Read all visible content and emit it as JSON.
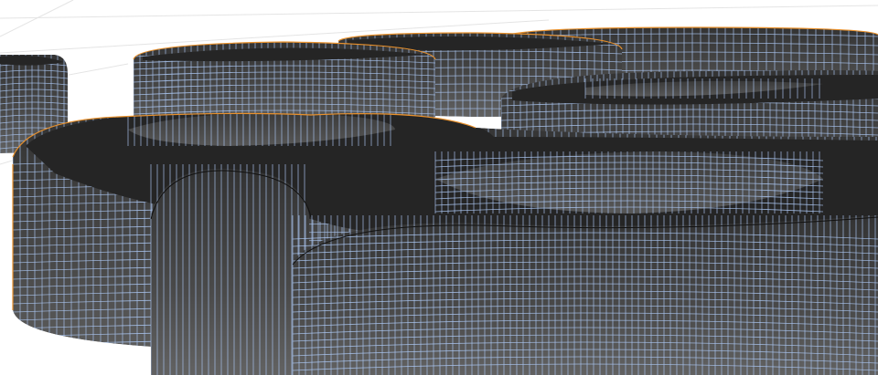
{
  "viewport": {
    "mode": "edit-mode-wireframe-overlay",
    "background_color": "#ffffff",
    "grid_color": "#e6e6e6",
    "surface_dark": "#2b2b2b",
    "surface_light": "#5e5e5e",
    "top_face_color": "#252525",
    "wire_color": "#a9c4ef",
    "selection_outline_color": "#e8902b",
    "objects": [
      {
        "label": "hole-left",
        "shape": "rounded-slot"
      },
      {
        "label": "hole-right",
        "shape": "rounded-slot"
      },
      {
        "label": "pill-far-left",
        "shape": "pill"
      },
      {
        "label": "pill-back-left",
        "shape": "pill"
      },
      {
        "label": "pill-back-mid",
        "shape": "pill"
      },
      {
        "label": "pill-right",
        "shape": "pill"
      },
      {
        "label": "pill-far-back",
        "shape": "pill"
      }
    ]
  }
}
